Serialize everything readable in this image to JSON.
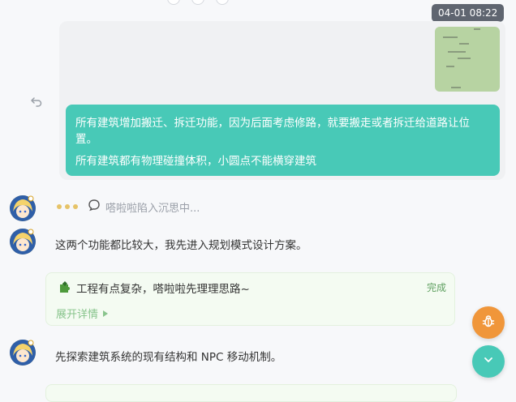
{
  "header": {
    "timestamp": "04-01 08:22"
  },
  "user_message": {
    "line1": "所有建筑增加搬迁、拆迁功能，因为后面考虑修路，就要搬走或者拆迁给道路让位",
    "line2": "置。",
    "line3": "所有建筑都有物理碰撞体积，小圆点不能横穿建筑"
  },
  "assistant": {
    "thinking_text": "嗒啦啦陷入沉思中...",
    "message1": "这两个功能都比较大，我先进入规划模式设计方案。",
    "task": {
      "title": "工程有点复杂，嗒啦啦先理理思路~",
      "status": "完成",
      "expand_label": "展开详情"
    },
    "message2": "先探索建筑系统的现有结构和 NPC 移动机制。"
  },
  "colors": {
    "user_bubble": "#48c9b7",
    "fab_bug": "#f0963a",
    "fab_down": "#48c9b7",
    "task_bg": "#f4fbf2"
  },
  "icons": [
    "undo-icon",
    "avatar",
    "chat-bubble-icon",
    "puzzle-icon",
    "bug-icon",
    "chevron-down-icon"
  ]
}
